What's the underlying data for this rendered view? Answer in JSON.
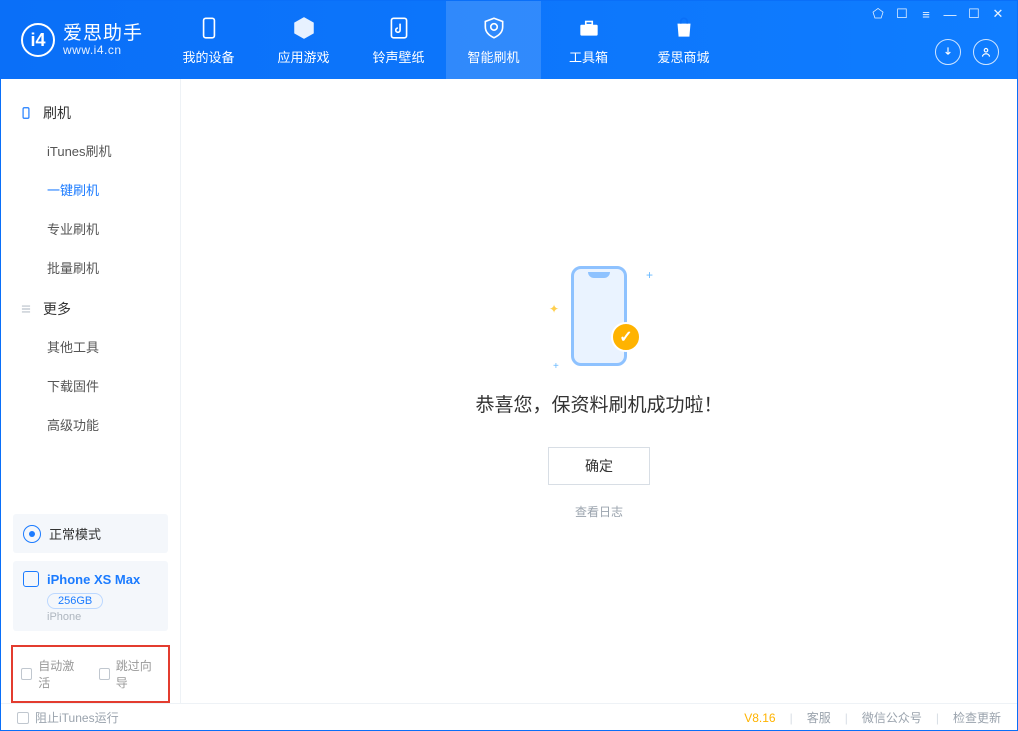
{
  "app": {
    "title": "爱思助手",
    "site": "www.i4.cn"
  },
  "nav": [
    {
      "label": "我的设备",
      "icon": "device"
    },
    {
      "label": "应用游戏",
      "icon": "cube"
    },
    {
      "label": "铃声壁纸",
      "icon": "music"
    },
    {
      "label": "智能刷机",
      "icon": "shield",
      "active": true
    },
    {
      "label": "工具箱",
      "icon": "toolbox"
    },
    {
      "label": "爱思商城",
      "icon": "bag"
    }
  ],
  "sidebar": {
    "cat1": {
      "title": "刷机"
    },
    "cat1_items": [
      "iTunes刷机",
      "一键刷机",
      "专业刷机",
      "批量刷机"
    ],
    "cat1_active_index": 1,
    "cat2": {
      "title": "更多"
    },
    "cat2_items": [
      "其他工具",
      "下载固件",
      "高级功能"
    ],
    "status": {
      "label": "正常模式"
    },
    "device": {
      "name": "iPhone XS Max",
      "capacity": "256GB",
      "type": "iPhone"
    },
    "options": {
      "auto_activate": "自动激活",
      "skip_wizard": "跳过向导"
    }
  },
  "main": {
    "success_message": "恭喜您，保资料刷机成功啦！",
    "ok_button": "确定",
    "view_log": "查看日志"
  },
  "footer": {
    "block_itunes": "阻止iTunes运行",
    "version": "V8.16",
    "links": [
      "客服",
      "微信公众号",
      "检查更新"
    ]
  }
}
